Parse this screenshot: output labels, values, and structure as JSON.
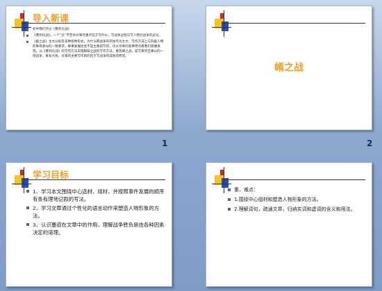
{
  "slides": [
    {
      "number": "1",
      "title": "导入新课",
      "bullets": [
        "初中我们学过《曹刿论战》",
        "《曹刿论战》，一个“论”字告诉文章的重点在于写什么，写战争过程与写人物对战争的议论。",
        "《殽之战》主文分别有多种各种形式，为什么把战争的开始作为主文，写作方法上与刻画人物形象有类似的一致要求，故事发展往往不是主要叙写的，仅从文章的叙事特点看我们很难发现。以《曹刿论战》的写作方法去理解殽之战的写作方法，秦晋崤之战，是写秦晋在崤山的一场战争，秦军大败，文章的主要写作目的在于写战争的成败的原因。"
      ]
    },
    {
      "number": "2",
      "title": "崤之战"
    },
    {
      "number": "",
      "title": "学习目标",
      "bullets": [
        "1、学习本文围绕中心选材、组材，并按照事件发展的顺序有条有理地记叙的写法。",
        "2、学习文章通过个性化的语言动作来塑造人物形象的方法。",
        "3、认识蹇叔在文章中的作用，理解战争胜负是由各种因素决定的道理。"
      ]
    },
    {
      "number": "",
      "bullets": [
        "重、难点：",
        "1.围绕中心组材和塑造人物形象的方法。",
        "2.理解词句，疏通文章，归纳实词和虚词的含义和用法。"
      ]
    }
  ]
}
